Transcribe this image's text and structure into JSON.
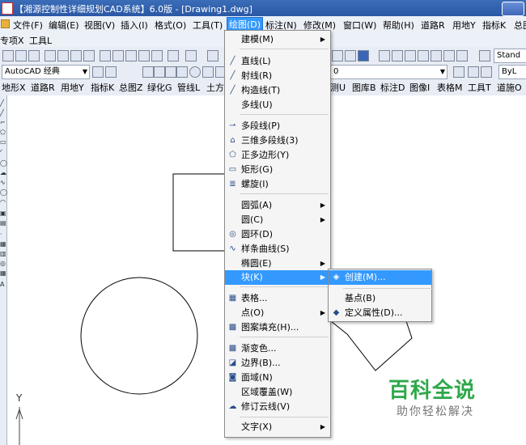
{
  "window": {
    "title": "【湘源控制性详细规划CAD系统】6.0版 - [Drawing1.dwg]"
  },
  "menubar": [
    {
      "label": "文件(F)"
    },
    {
      "label": "编辑(E)"
    },
    {
      "label": "视图(V)"
    },
    {
      "label": "插入(I)"
    },
    {
      "label": "格式(O)"
    },
    {
      "label": "工具(T)"
    },
    {
      "label": "绘图(D)",
      "active": true
    },
    {
      "label": "标注(N)"
    },
    {
      "label": "修改(M)"
    },
    {
      "label": "窗口(W)"
    },
    {
      "label": "帮助(H)"
    },
    {
      "label": "道路R"
    },
    {
      "label": "用地Y"
    },
    {
      "label": "指标K"
    },
    {
      "label": "总图"
    }
  ],
  "menubar2": [
    {
      "label": "专项X"
    },
    {
      "label": "工具L"
    }
  ],
  "toolbar": {
    "workspace": "AutoCAD 经典",
    "layer_value": "0",
    "textstyle": "Stand",
    "color": "ByL"
  },
  "toolbar4": [
    {
      "label": "地形X"
    },
    {
      "label": "道路R"
    },
    {
      "label": "用地Y"
    },
    {
      "label": "指标K"
    },
    {
      "label": "总图Z"
    },
    {
      "label": "绿化G"
    },
    {
      "label": "管线L"
    },
    {
      "label": "土方"
    },
    {
      "label": "测U"
    },
    {
      "label": "图库B"
    },
    {
      "label": "标注D"
    },
    {
      "label": "图像I"
    },
    {
      "label": "表格M"
    },
    {
      "label": "工具T"
    },
    {
      "label": "道施O"
    }
  ],
  "draw_menu": {
    "items": [
      {
        "label": "建模(M)",
        "icon": "",
        "submenu": true
      },
      {
        "separator": true
      },
      {
        "label": "直线(L)",
        "icon": "line-icon"
      },
      {
        "label": "射线(R)",
        "icon": "ray-icon"
      },
      {
        "label": "构造线(T)",
        "icon": "xline-icon"
      },
      {
        "label": "多线(U)",
        "icon": ""
      },
      {
        "separator": true
      },
      {
        "label": "多段线(P)",
        "icon": "polyline-icon"
      },
      {
        "label": "三维多段线(3)",
        "icon": "3dpolyline-icon"
      },
      {
        "label": "正多边形(Y)",
        "icon": "polygon-icon"
      },
      {
        "label": "矩形(G)",
        "icon": "rectangle-icon"
      },
      {
        "label": "螺旋(I)",
        "icon": "helix-icon"
      },
      {
        "separator": true
      },
      {
        "label": "圆弧(A)",
        "icon": "",
        "submenu": true
      },
      {
        "label": "圆(C)",
        "icon": "",
        "submenu": true
      },
      {
        "label": "圆环(D)",
        "icon": "donut-icon"
      },
      {
        "label": "样条曲线(S)",
        "icon": "spline-icon"
      },
      {
        "label": "椭圆(E)",
        "icon": "",
        "submenu": true
      },
      {
        "label": "块(K)",
        "icon": "",
        "submenu": true,
        "highlighted": true
      },
      {
        "separator": true
      },
      {
        "label": "表格...",
        "icon": "table-icon"
      },
      {
        "label": "点(O)",
        "icon": "",
        "submenu": true
      },
      {
        "label": "图案填充(H)...",
        "icon": "hatch-icon"
      },
      {
        "separator": true
      },
      {
        "label": "渐变色...",
        "icon": "gradient-icon"
      },
      {
        "label": "边界(B)...",
        "icon": "boundary-icon"
      },
      {
        "label": "面域(N)",
        "icon": "region-icon"
      },
      {
        "label": "区域覆盖(W)",
        "icon": ""
      },
      {
        "label": "修订云线(V)",
        "icon": "revcloud-icon"
      },
      {
        "separator": true
      },
      {
        "label": "文字(X)",
        "icon": "",
        "submenu": true
      }
    ]
  },
  "block_submenu": {
    "items": [
      {
        "label": "创建(M)...",
        "icon": "block-create-icon",
        "highlighted": true
      },
      {
        "separator": true
      },
      {
        "label": "基点(B)",
        "icon": ""
      },
      {
        "label": "定义属性(D)...",
        "icon": "define-attribute-icon"
      }
    ]
  },
  "canvas": {
    "ucs_y_label": "Y"
  },
  "watermark": {
    "main": "百科全说",
    "sub": "助你轻松解决"
  },
  "colors": {
    "menu_highlight": "#3399ff",
    "watermark_green": "#2ea84a",
    "titlebar": "#2a58a5"
  }
}
